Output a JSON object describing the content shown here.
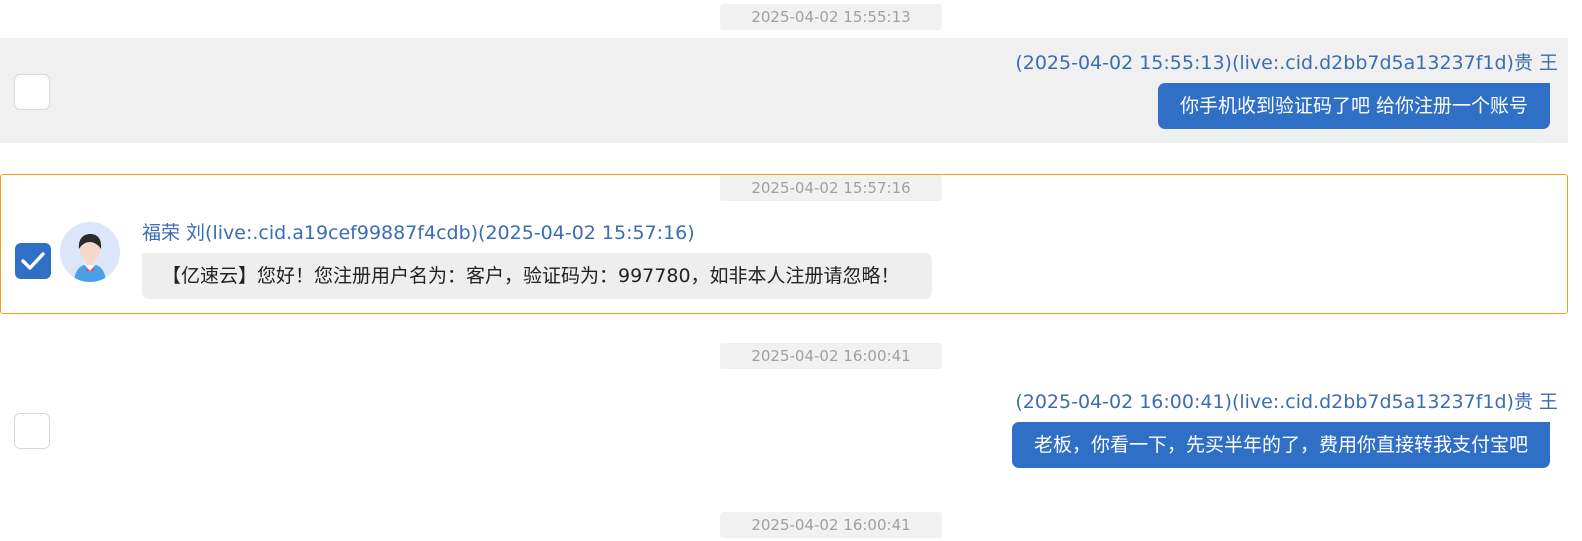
{
  "messages": [
    {
      "timestamp": "2025-04-02 15:55:13",
      "direction": "outgoing",
      "selected": false,
      "sender": "(2025-04-02 15:55:13)(live:.cid.d2bb7d5a13237f1d)贵 王",
      "text": "你手机收到验证码了吧  给你注册一个账号"
    },
    {
      "timestamp": "2025-04-02 15:57:16",
      "direction": "incoming",
      "selected": true,
      "sender": "福荣 刘(live:.cid.a19cef99887f4cdb)(2025-04-02 15:57:16)",
      "text": "【亿速云】您好！您注册用户名为：客户，验证码为：997780，如非本人注册请忽略！"
    },
    {
      "timestamp": "2025-04-02 16:00:41",
      "direction": "outgoing",
      "selected": false,
      "sender": "(2025-04-02 16:00:41)(live:.cid.d2bb7d5a13237f1d)贵 王",
      "text": "老板，你看一下，先买半年的了，费用你直接转我支付宝吧"
    },
    {
      "timestamp": "2025-04-02 16:00:41"
    }
  ],
  "colors": {
    "outgoing_bubble": "#2f6fc6",
    "incoming_bubble": "#eeeeee",
    "sender_name": "#3b6db4",
    "selection_border": "#f0a020",
    "checkbox_checked": "#2f6fc6"
  },
  "icons": {
    "checkbox_checked": "checkmark-icon",
    "avatar": "user-avatar-icon"
  }
}
